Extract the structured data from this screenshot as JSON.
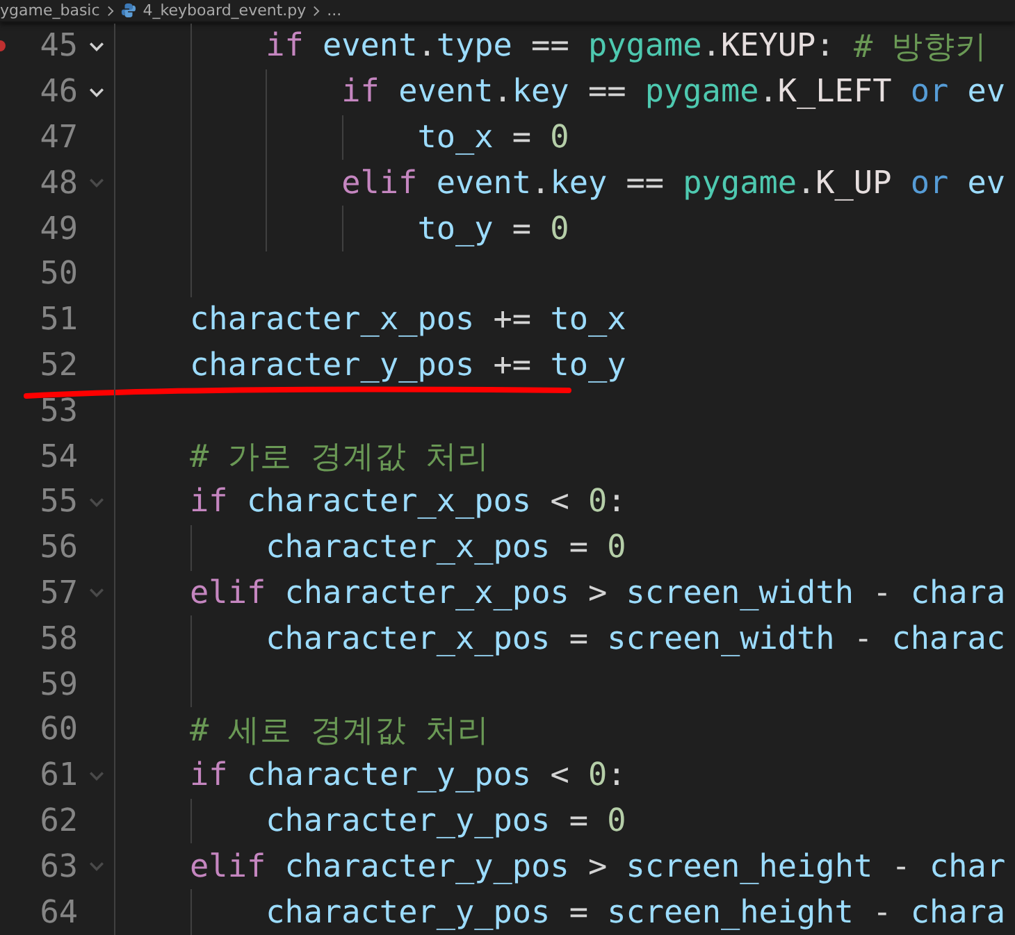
{
  "breadcrumb": {
    "items": [
      {
        "kind": "folder",
        "label": "ygame_basic"
      },
      {
        "kind": "file",
        "label": "4_keyboard_event.py"
      },
      {
        "kind": "more",
        "label": "..."
      }
    ]
  },
  "editor": {
    "lines": [
      {
        "number": "45",
        "fold": true,
        "fold_emphasis": true,
        "breakpoint": true,
        "underlined": false,
        "tokens": [
          {
            "kind": "kw",
            "text": "        if "
          },
          {
            "kind": "var",
            "text": "event"
          },
          {
            "kind": "op",
            "text": "."
          },
          {
            "kind": "var",
            "text": "type"
          },
          {
            "kind": "op",
            "text": " == "
          },
          {
            "kind": "mod",
            "text": "pygame"
          },
          {
            "kind": "op",
            "text": "."
          },
          {
            "kind": "const",
            "text": "KEYUP"
          },
          {
            "kind": "op",
            "text": ": "
          },
          {
            "kind": "cmt",
            "text": "# 방향키"
          }
        ]
      },
      {
        "number": "46",
        "fold": true,
        "fold_emphasis": true,
        "breakpoint": false,
        "underlined": false,
        "tokens": [
          {
            "kind": "kw",
            "text": "            if "
          },
          {
            "kind": "var",
            "text": "event"
          },
          {
            "kind": "op",
            "text": "."
          },
          {
            "kind": "var",
            "text": "key"
          },
          {
            "kind": "op",
            "text": " == "
          },
          {
            "kind": "mod",
            "text": "pygame"
          },
          {
            "kind": "op",
            "text": "."
          },
          {
            "kind": "const",
            "text": "K_LEFT"
          },
          {
            "kind": "logic",
            "text": " or "
          },
          {
            "kind": "var",
            "text": "ev"
          }
        ]
      },
      {
        "number": "47",
        "fold": false,
        "breakpoint": false,
        "underlined": false,
        "tokens": [
          {
            "kind": "var",
            "text": "                to_x"
          },
          {
            "kind": "op",
            "text": " = "
          },
          {
            "kind": "num",
            "text": "0"
          }
        ]
      },
      {
        "number": "48",
        "fold": true,
        "fold_emphasis": false,
        "breakpoint": false,
        "underlined": false,
        "tokens": [
          {
            "kind": "kw",
            "text": "            elif "
          },
          {
            "kind": "var",
            "text": "event"
          },
          {
            "kind": "op",
            "text": "."
          },
          {
            "kind": "var",
            "text": "key"
          },
          {
            "kind": "op",
            "text": " == "
          },
          {
            "kind": "mod",
            "text": "pygame"
          },
          {
            "kind": "op",
            "text": "."
          },
          {
            "kind": "const",
            "text": "K_UP"
          },
          {
            "kind": "logic",
            "text": " or "
          },
          {
            "kind": "var",
            "text": "ev"
          }
        ]
      },
      {
        "number": "49",
        "fold": false,
        "breakpoint": false,
        "underlined": false,
        "tokens": [
          {
            "kind": "var",
            "text": "                to_y"
          },
          {
            "kind": "op",
            "text": " = "
          },
          {
            "kind": "num",
            "text": "0"
          }
        ]
      },
      {
        "number": "50",
        "fold": false,
        "breakpoint": false,
        "underlined": false
      },
      {
        "number": "51",
        "fold": false,
        "breakpoint": false,
        "underlined": false,
        "tokens": [
          {
            "kind": "var",
            "text": "    character_x_pos"
          },
          {
            "kind": "op",
            "text": " += "
          },
          {
            "kind": "var",
            "text": "to_x"
          }
        ]
      },
      {
        "number": "52",
        "fold": false,
        "breakpoint": false,
        "underlined": true,
        "tokens": [
          {
            "kind": "var",
            "text": "    character_y_pos"
          },
          {
            "kind": "op",
            "text": " += "
          },
          {
            "kind": "var",
            "text": "to_y"
          }
        ]
      },
      {
        "number": "53",
        "fold": false,
        "breakpoint": false,
        "underlined": false
      },
      {
        "number": "54",
        "fold": false,
        "breakpoint": false,
        "underlined": false,
        "tokens": [
          {
            "kind": "cmt",
            "text": "    # 가로 경계값 처리"
          }
        ]
      },
      {
        "number": "55",
        "fold": true,
        "fold_emphasis": false,
        "breakpoint": false,
        "underlined": false,
        "tokens": [
          {
            "kind": "kw",
            "text": "    if "
          },
          {
            "kind": "var",
            "text": "character_x_pos"
          },
          {
            "kind": "op",
            "text": " < "
          },
          {
            "kind": "num",
            "text": "0"
          },
          {
            "kind": "op",
            "text": ":"
          }
        ]
      },
      {
        "number": "56",
        "fold": false,
        "breakpoint": false,
        "underlined": false,
        "tokens": [
          {
            "kind": "var",
            "text": "        character_x_pos"
          },
          {
            "kind": "op",
            "text": " = "
          },
          {
            "kind": "num",
            "text": "0"
          }
        ]
      },
      {
        "number": "57",
        "fold": true,
        "fold_emphasis": false,
        "breakpoint": false,
        "underlined": false,
        "tokens": [
          {
            "kind": "kw",
            "text": "    elif "
          },
          {
            "kind": "var",
            "text": "character_x_pos"
          },
          {
            "kind": "op",
            "text": " > "
          },
          {
            "kind": "var",
            "text": "screen_width"
          },
          {
            "kind": "op",
            "text": " - "
          },
          {
            "kind": "var",
            "text": "chara"
          }
        ]
      },
      {
        "number": "58",
        "fold": false,
        "breakpoint": false,
        "underlined": false,
        "tokens": [
          {
            "kind": "var",
            "text": "        character_x_pos"
          },
          {
            "kind": "op",
            "text": " = "
          },
          {
            "kind": "var",
            "text": "screen_width"
          },
          {
            "kind": "op",
            "text": " - "
          },
          {
            "kind": "var",
            "text": "charac"
          }
        ]
      },
      {
        "number": "59",
        "fold": false,
        "breakpoint": false,
        "underlined": false
      },
      {
        "number": "60",
        "fold": false,
        "breakpoint": false,
        "underlined": false,
        "tokens": [
          {
            "kind": "cmt",
            "text": "    # 세로 경계값 처리"
          }
        ]
      },
      {
        "number": "61",
        "fold": true,
        "fold_emphasis": false,
        "breakpoint": false,
        "underlined": false,
        "tokens": [
          {
            "kind": "kw",
            "text": "    if "
          },
          {
            "kind": "var",
            "text": "character_y_pos"
          },
          {
            "kind": "op",
            "text": " < "
          },
          {
            "kind": "num",
            "text": "0"
          },
          {
            "kind": "op",
            "text": ":"
          }
        ]
      },
      {
        "number": "62",
        "fold": false,
        "breakpoint": false,
        "underlined": false,
        "tokens": [
          {
            "kind": "var",
            "text": "        character_y_pos"
          },
          {
            "kind": "op",
            "text": " = "
          },
          {
            "kind": "num",
            "text": "0"
          }
        ]
      },
      {
        "number": "63",
        "fold": true,
        "fold_emphasis": false,
        "breakpoint": false,
        "underlined": false,
        "tokens": [
          {
            "kind": "kw",
            "text": "    elif "
          },
          {
            "kind": "var",
            "text": "character_y_pos"
          },
          {
            "kind": "op",
            "text": " > "
          },
          {
            "kind": "var",
            "text": "screen_height"
          },
          {
            "kind": "op",
            "text": " - "
          },
          {
            "kind": "var",
            "text": "char"
          }
        ]
      },
      {
        "number": "64",
        "fold": false,
        "breakpoint": false,
        "underlined": false,
        "tokens": [
          {
            "kind": "var",
            "text": "        character_y_pos"
          },
          {
            "kind": "op",
            "text": " = "
          },
          {
            "kind": "var",
            "text": "screen_height"
          },
          {
            "kind": "op",
            "text": " - "
          },
          {
            "kind": "var",
            "text": "chara"
          }
        ]
      }
    ]
  }
}
